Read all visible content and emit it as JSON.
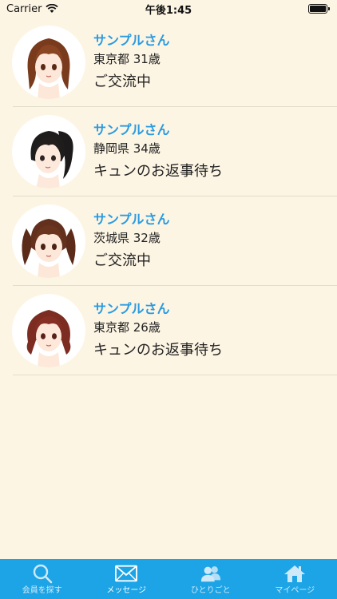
{
  "status_bar": {
    "carrier": "Carrier",
    "time": "午後1:45"
  },
  "messages": [
    {
      "name": "サンプルさん",
      "location": "東京都 31歳",
      "status": "ご交流中",
      "avatar_icon": "avatar-brown-long-hair"
    },
    {
      "name": "サンプルさん",
      "location": "静岡県 34歳",
      "status": "キュンのお返事待ち",
      "avatar_icon": "avatar-black-ponytail"
    },
    {
      "name": "サンプルさん",
      "location": "茨城県 32歳",
      "status": "ご交流中",
      "avatar_icon": "avatar-brown-twintails"
    },
    {
      "name": "サンプルさん",
      "location": "東京都 26歳",
      "status": "キュンのお返事待ち",
      "avatar_icon": "avatar-auburn-wavy"
    }
  ],
  "tabs": [
    {
      "label": "会員を探す",
      "icon": "search-icon"
    },
    {
      "label": "メッセージ",
      "icon": "mail-icon",
      "active": true
    },
    {
      "label": "ひとりごと",
      "icon": "people-icon"
    },
    {
      "label": "マイページ",
      "icon": "home-icon"
    }
  ],
  "colors": {
    "background": "#fdf5e4",
    "accent": "#2a9be0",
    "tab_bar": "#1ca4e6"
  }
}
